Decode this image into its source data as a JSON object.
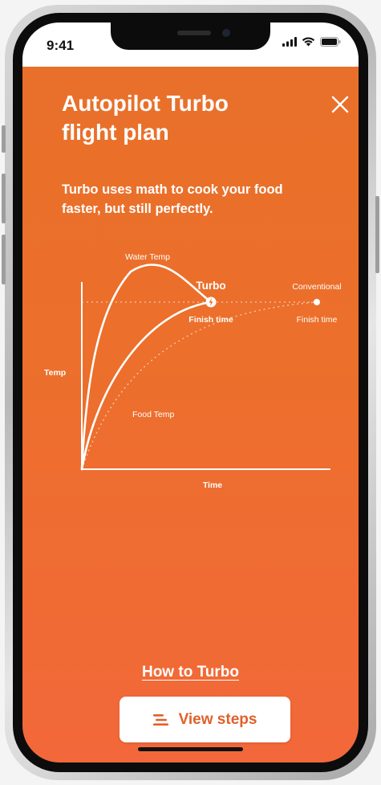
{
  "status_bar": {
    "time": "9:41",
    "icons": [
      "signal-icon",
      "wifi-icon",
      "battery-icon"
    ]
  },
  "header": {
    "title": "Autopilot Turbo flight plan",
    "close_icon": "close-icon"
  },
  "description": "Turbo uses math to cook your food faster, but still perfectly.",
  "diagram": {
    "labels": {
      "water_temp": "Water Temp",
      "turbo": "Turbo",
      "turbo_finish": "Finish time",
      "conventional": "Conventional",
      "conventional_finish": "Finish time",
      "y_axis": "Temp",
      "food_temp": "Food Temp",
      "x_axis": "Time"
    }
  },
  "footer": {
    "link_label": "How to Turbo",
    "button_label": "View steps",
    "button_icon": "list-icon"
  },
  "colors": {
    "background_top": "#e8702a",
    "background_bottom": "#f2683a",
    "accent": "#e0602a",
    "text": "#ffffff"
  }
}
